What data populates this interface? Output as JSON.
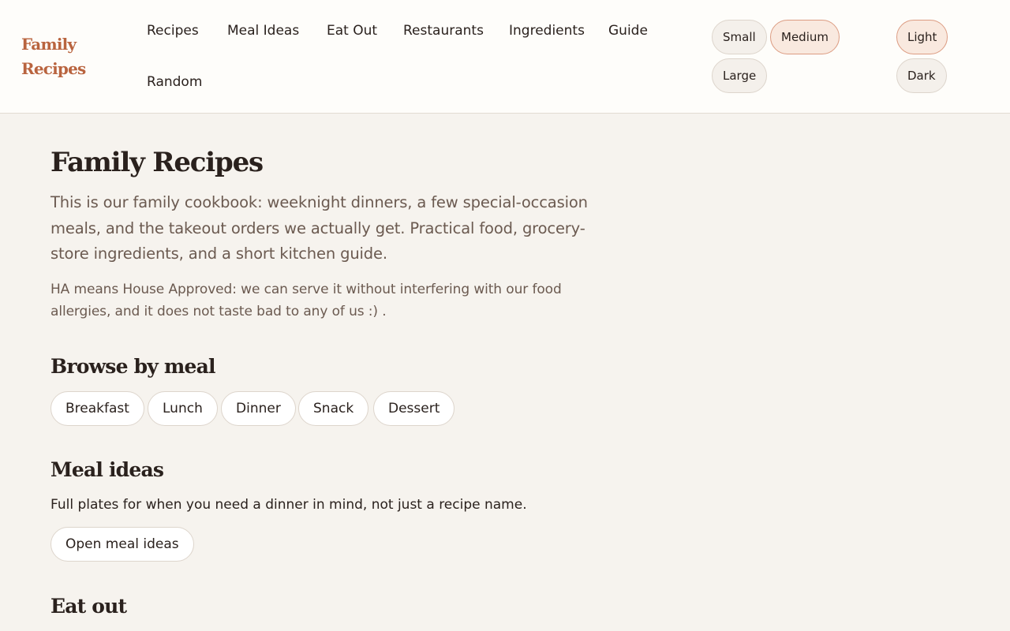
{
  "brand": {
    "name": "Family Recipes"
  },
  "nav": {
    "items": [
      {
        "label": "Recipes"
      },
      {
        "label": "Meal Ideas"
      },
      {
        "label": "Eat Out"
      },
      {
        "label": "Restaurants"
      },
      {
        "label": "Ingredients"
      },
      {
        "label": "Guide"
      },
      {
        "label": "Random"
      }
    ]
  },
  "text_size": {
    "options": [
      "Small",
      "Medium",
      "Large"
    ],
    "selected": "Medium"
  },
  "theme": {
    "options": [
      "Light",
      "Dark"
    ],
    "selected": "Light"
  },
  "colors": {
    "accent": "#b9643f",
    "page_background": "#f6f3ee",
    "header_background": "#fefdfa",
    "selected_pill": "#f9e9df"
  },
  "page": {
    "title": "Family Recipes",
    "lede": "This is our family cookbook: weeknight dinners, a few special-occasion meals, and the takeout orders we actually get. Practical food, grocery-store ingredients, and a short kitchen guide.",
    "note": "HA means House Approved: we can serve it without interfering with our food allergies, and it does not taste bad to any of us :) ."
  },
  "browse_by_meal": {
    "heading": "Browse by meal",
    "chips": [
      "Breakfast",
      "Lunch",
      "Dinner",
      "Snack",
      "Dessert"
    ]
  },
  "meal_ideas": {
    "heading": "Meal ideas",
    "description": "Full plates for when you need a dinner in mind, not just a recipe name.",
    "button_label": "Open meal ideas"
  },
  "eat_out": {
    "heading": "Eat out"
  }
}
